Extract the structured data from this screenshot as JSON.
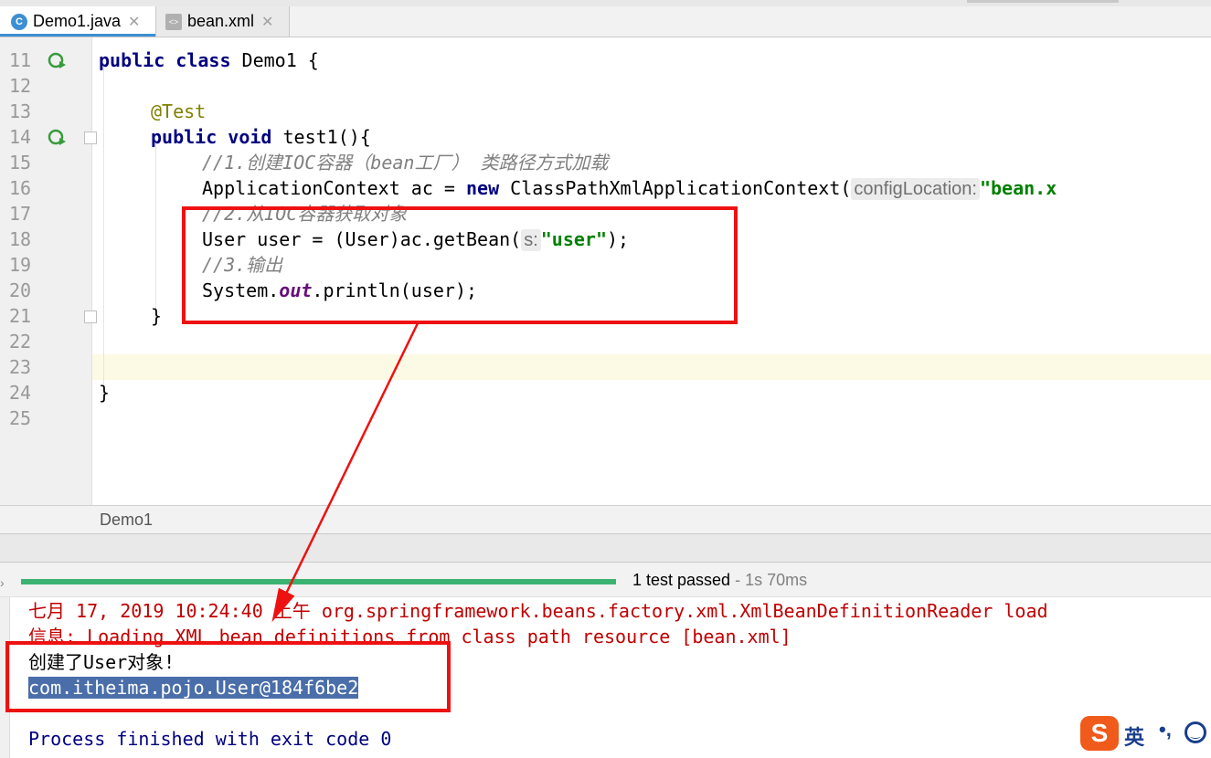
{
  "tabs": [
    {
      "label": "Demo1.java",
      "icon": "java-class-icon",
      "active": true
    },
    {
      "label": "bean.xml",
      "icon": "xml-file-icon",
      "active": false
    }
  ],
  "editor": {
    "lines": [
      {
        "num": "11"
      },
      {
        "num": "12"
      },
      {
        "num": "13"
      },
      {
        "num": "14"
      },
      {
        "num": "15"
      },
      {
        "num": "16"
      },
      {
        "num": "17"
      },
      {
        "num": "18"
      },
      {
        "num": "19"
      },
      {
        "num": "20"
      },
      {
        "num": "21"
      },
      {
        "num": "22"
      },
      {
        "num": "23"
      },
      {
        "num": "24"
      },
      {
        "num": "25"
      }
    ],
    "code": {
      "l11_kw1": "public",
      "l11_kw2": "class",
      "l11_rest": " Demo1 {",
      "l13_ann": "@Test",
      "l14_kw1": "public",
      "l14_kw2": "void",
      "l14_rest": " test1(){",
      "l15_cmt": "//1.创建IOC容器（bean工厂） 类路径方式加载",
      "l16_a": "ApplicationContext ac = ",
      "l16_kw": "new",
      "l16_b": " ClassPathXmlApplicationContext(",
      "l16_hint": "configLocation:",
      "l16_str": "\"bean.x",
      "l17_cmt": "//2.从IOC容器获取对象",
      "l18_a": "User user = (User)ac.getBean(",
      "l18_hint": "s:",
      "l18_str": "\"user\"",
      "l18_b": ");",
      "l19_cmt": "//3.输出",
      "l20_a": "System.",
      "l20_static": "out",
      "l20_b": ".println(user);",
      "l21": "}",
      "l24": "}"
    }
  },
  "breadcrumb": "Demo1",
  "run": {
    "progress_percent": 100,
    "status": "1 test passed",
    "duration": " - 1s 70ms"
  },
  "console": {
    "line1": "七月 17, 2019 10:24:40 上午 org.springframework.beans.factory.xml.XmlBeanDefinitionReader load",
    "line2": "信息: Loading XML bean definitions from class path resource [bean.xml]",
    "line3": "创建了User对象!",
    "line4": "com.itheima.pojo.User@184f6be2",
    "line5": "Process finished with exit code 0"
  },
  "ime": {
    "logo": "S",
    "mode": "英",
    "punct": "•,"
  },
  "colors": {
    "annotation_red": "#ee1111",
    "keyword": "#000080",
    "string": "#008000",
    "progress": "#3cb371",
    "selection": "#4a6ea9"
  }
}
